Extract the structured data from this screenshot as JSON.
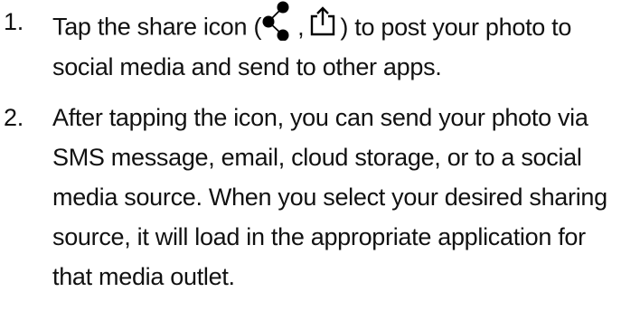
{
  "steps": [
    {
      "number": "1.",
      "line1_before_icon": "Tap the share icon (",
      "icon_separator": ",",
      "line1_after_icon": ") to post your photo to",
      "line2": "social media and send to other apps.",
      "icons": [
        "android-share-icon",
        "ios-share-icon"
      ]
    },
    {
      "number": "2.",
      "lines": [
        "After tapping the icon, you can send your photo via",
        "SMS message, email, cloud storage, or to a social",
        "media source. When you select your desired sharing",
        "source, it will load in the appropriate application for",
        "that media outlet."
      ]
    }
  ]
}
